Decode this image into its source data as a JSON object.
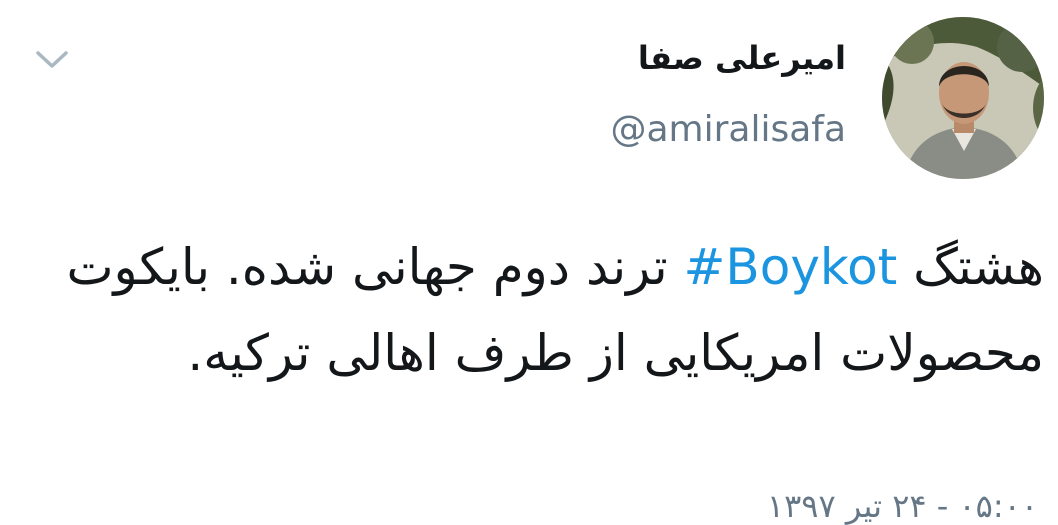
{
  "tweet": {
    "author": {
      "display_name": "امیرعلی صفا",
      "handle": "@amiralisafa"
    },
    "text": {
      "before_hashtag": "هشتگ ",
      "hashtag": "#Boykot",
      "after_hashtag": " ترند دوم جهانی شده. بایکوت محصولات امریکایی از طرف اهالی ترکیه."
    },
    "timestamp": "۰۵:۰۰ - ۲۴ تیر ۱۳۹۷"
  },
  "icons": {
    "menu": "chevron-down-icon"
  },
  "colors": {
    "text": "#14171a",
    "secondary": "#657786",
    "link": "#1b95e0",
    "background": "#ffffff"
  }
}
